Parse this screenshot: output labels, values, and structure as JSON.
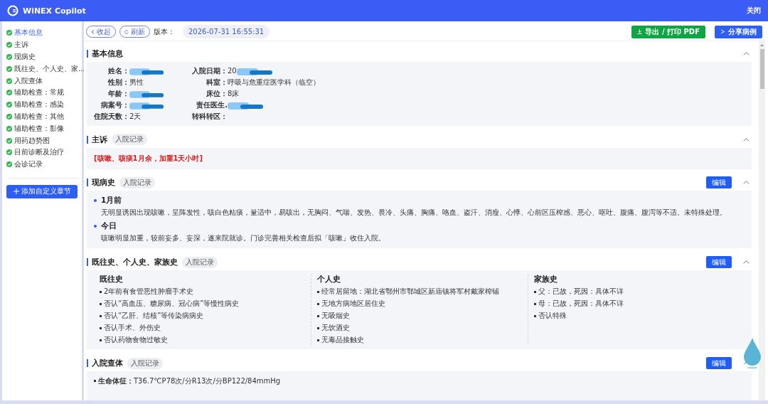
{
  "header": {
    "app_name": "WiNEX Copilot",
    "close": "关闭"
  },
  "sidebar": {
    "items": [
      {
        "label": "基本信息",
        "selected": true,
        "done": true
      },
      {
        "label": "主诉",
        "selected": false,
        "done": true
      },
      {
        "label": "现病史",
        "selected": false,
        "done": true
      },
      {
        "label": "既往史、个人史、家...",
        "selected": false,
        "done": true
      },
      {
        "label": "入院查体",
        "selected": false,
        "done": true
      },
      {
        "label": "辅助检查：常规",
        "selected": false,
        "done": true
      },
      {
        "label": "辅助检查：感染",
        "selected": false,
        "done": true
      },
      {
        "label": "辅助检查：其他",
        "selected": false,
        "done": true
      },
      {
        "label": "辅助检查：影像",
        "selected": false,
        "done": true
      },
      {
        "label": "用药趋势图",
        "selected": false,
        "done": true
      },
      {
        "label": "目前诊断及治疗",
        "selected": false,
        "done": true
      },
      {
        "label": "会诊记录",
        "selected": false,
        "done": true
      }
    ],
    "add_button": "添加自定义章节"
  },
  "toolbar": {
    "collapse": "收起",
    "refresh": "刷新",
    "version_label": "版本：",
    "version": "2026-07-31 16:55:31",
    "export": "导出 / 打印 PDF",
    "share": "分享病例"
  },
  "sections": [
    {
      "kind": "info",
      "title": "基本信息",
      "fields": [
        {
          "label": "姓名：",
          "redacted": true
        },
        {
          "label": "入院日期：",
          "value": "20",
          "redacted": true
        },
        {
          "label": "性别：",
          "value": "男性",
          "redacted": false
        },
        {
          "label": "科室：",
          "value": "呼吸与危重症医学科（临空）",
          "redacted": false
        },
        {
          "label": "年龄：",
          "redacted": true
        },
        {
          "label": "床位：",
          "value": "8床",
          "redacted": false
        },
        {
          "label": "病案号：",
          "redacted": true
        },
        {
          "label": "责任医生.",
          "redacted": true
        },
        {
          "label": "住院天数：",
          "value": "2天",
          "redacted": false
        },
        {
          "label": "转科转区：",
          "redacted": false
        }
      ]
    },
    {
      "kind": "text",
      "title": "主诉",
      "tag": "入院记录",
      "text": "[咳嗽、咳痰1月余，加重1天小时]"
    },
    {
      "kind": "timeline",
      "title": "现病史",
      "tag": "入院记录",
      "edit": "编辑",
      "entries": [
        {
          "time": "1月前",
          "text": "无明显诱因出现咳嗽，呈阵发性，咳白色粘痰，量适中，易咳出，无胸闷、气喘、发热、畏冷、头痛、胸痛、咯血、盗汗、消瘦、心悸、心前区压榨感、恶心、呕吐、腹痛、腹泻等不适。未特殊处理。"
        },
        {
          "time": "今日",
          "text": "咳嗽明显加重，较前妄多、妄深，遂来院就诊。门诊完善相关检查后拟「咳嗽」收住入院。"
        }
      ]
    },
    {
      "kind": "columns",
      "title": "既往史、个人史、家族史",
      "tag": "入院记录",
      "edit": "编辑",
      "columns": [
        {
          "heading": "既往史",
          "items": [
            "2年前有食管恶性肿瘤手术史",
            "否认“高血压、糖尿病、冠心病”等慢性病史",
            "否认“乙肝、结核”等传染病病史",
            "否认手术、外伤史",
            "否认药物食物过敏史"
          ]
        },
        {
          "heading": "个人史",
          "items": [
            "经常居留地：湖北省鄂州市鄂城区新庙镇将军村戴家榨铺",
            "无地方病地区居住史",
            "无吸烟史",
            "无饮酒史",
            "无毒品接触史"
          ]
        },
        {
          "heading": "家族史",
          "items": [
            "父：已故，死因：具体不详",
            "母：已故，死因：具体不详",
            "否认特殊"
          ]
        }
      ]
    },
    {
      "kind": "list",
      "title": "入院查体",
      "tag": "入院记录",
      "edit": "编辑",
      "items": [
        {
          "label": "生命体征：",
          "text": "T36.7℃P78次/分R13次/分BP122/84mmHg"
        }
      ]
    }
  ]
}
